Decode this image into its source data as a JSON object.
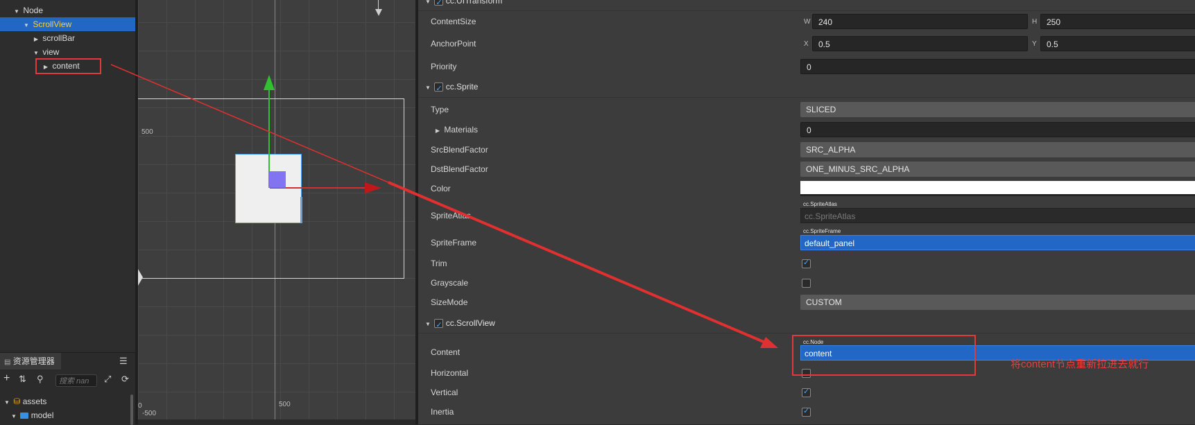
{
  "hierarchy": {
    "items": [
      {
        "label": "Node",
        "expanded": true
      },
      {
        "label": "ScrollView",
        "expanded": true,
        "selected": true
      },
      {
        "label": "scrollBar",
        "expanded": false
      },
      {
        "label": "view",
        "expanded": true
      },
      {
        "label": "content",
        "expanded": false,
        "highlighted": true
      }
    ]
  },
  "assets": {
    "tab_label": "资源管理器",
    "search_placeholder": "搜索 nan",
    "items": [
      {
        "label": "assets",
        "icon": "database-icon"
      },
      {
        "label": "model",
        "icon": "folder-icon"
      }
    ]
  },
  "scene": {
    "labels": {
      "y500": "500",
      "x500": "500",
      "x0": "0",
      "yneg500": "-500"
    }
  },
  "inspector": {
    "uitransform": {
      "title": "cc.UITransform",
      "content_size": {
        "label": "ContentSize",
        "w_tag": "W",
        "w": "240",
        "h_tag": "H",
        "h": "250"
      },
      "anchor_point": {
        "label": "AnchorPoint",
        "x_tag": "X",
        "x": "0.5",
        "y_tag": "Y",
        "y": "0.5"
      },
      "priority": {
        "label": "Priority",
        "value": "0"
      }
    },
    "sprite": {
      "title": "cc.Sprite",
      "type": {
        "label": "Type",
        "value": "SLICED"
      },
      "materials": {
        "label": "Materials",
        "value": "0"
      },
      "src_blend": {
        "label": "SrcBlendFactor",
        "value": "SRC_ALPHA"
      },
      "dst_blend": {
        "label": "DstBlendFactor",
        "value": "ONE_MINUS_SRC_ALPHA"
      },
      "color": {
        "label": "Color",
        "value": "#ffffff"
      },
      "sprite_atlas": {
        "label": "SpriteAtlas",
        "tag": "cc.SpriteAtlas",
        "placeholder": "cc.SpriteAtlas"
      },
      "sprite_frame": {
        "label": "SpriteFrame",
        "tag": "cc.SpriteFrame",
        "value": "default_panel"
      },
      "trim": {
        "label": "Trim",
        "checked": true
      },
      "grayscale": {
        "label": "Grayscale",
        "checked": false
      },
      "size_mode": {
        "label": "SizeMode",
        "value": "CUSTOM"
      }
    },
    "scrollview": {
      "title": "cc.ScrollView",
      "content": {
        "label": "Content",
        "tag": "cc.Node",
        "value": "content"
      },
      "horizontal": {
        "label": "Horizontal",
        "checked": false
      },
      "vertical": {
        "label": "Vertical",
        "checked": true
      },
      "inertia": {
        "label": "Inertia",
        "checked": true
      }
    }
  },
  "annotation": {
    "text": "将content节点重新拉进去就行",
    "color": "#e64040"
  }
}
